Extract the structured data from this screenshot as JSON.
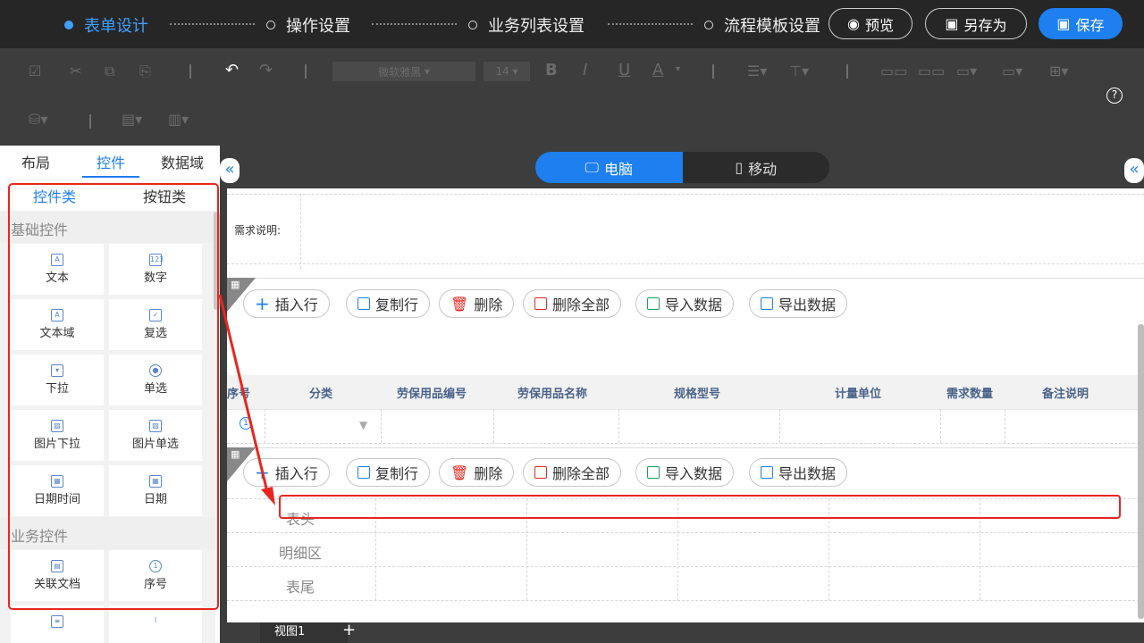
{
  "steps": [
    {
      "label": "表单设计",
      "active": true
    },
    {
      "label": "操作设置",
      "active": false
    },
    {
      "label": "业务列表设置",
      "active": false
    },
    {
      "label": "流程模板设置",
      "active": false
    }
  ],
  "top_buttons": {
    "preview": "预览",
    "save_as": "另存为",
    "save": "保存"
  },
  "toolbar": {
    "font_name": "微软雅黑",
    "font_size": "14",
    "bold": "B",
    "italic": "I",
    "underline": "U",
    "color": "A",
    "help": "?"
  },
  "left_panel": {
    "tabs": [
      "布局",
      "控件",
      "数据域"
    ],
    "subtabs": [
      "控件类",
      "按钮类"
    ],
    "cat_basic": "基础控件",
    "cat_business": "业务控件",
    "controls": [
      "文本",
      "数字",
      "文本域",
      "复选",
      "下拉",
      "单选",
      "图片下拉",
      "图片单选",
      "日期时间",
      "日期",
      "关联文档",
      "序号"
    ]
  },
  "device": {
    "pc": "电脑",
    "mobile": "移动"
  },
  "canvas": {
    "req_label": "需求说明:",
    "buttons": [
      "插入行",
      "复制行",
      "删除",
      "删除全部",
      "导入数据",
      "导出数据"
    ],
    "columns": [
      "序号",
      "分类",
      "劳保用品编号",
      "劳保用品名称",
      "规格型号",
      "计量单位",
      "需求数量",
      "备注说明"
    ],
    "sections": [
      "表头",
      "明细区",
      "表尾"
    ]
  },
  "bottom": {
    "view": "视图1",
    "add": "+"
  },
  "colors": {
    "accent": "#1d7ff0",
    "highlight": "#e8261f",
    "header_text": "#4a6389"
  }
}
